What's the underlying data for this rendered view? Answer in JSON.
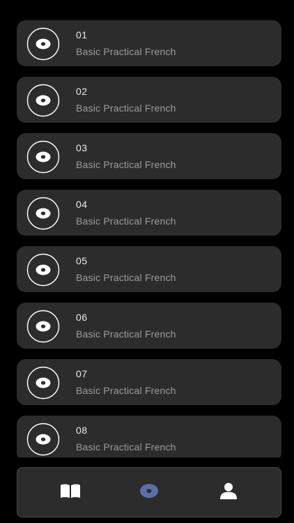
{
  "tracks": [
    {
      "number": "01",
      "subtitle": "Basic Practical French"
    },
    {
      "number": "02",
      "subtitle": "Basic Practical French"
    },
    {
      "number": "03",
      "subtitle": "Basic Practical French"
    },
    {
      "number": "04",
      "subtitle": "Basic Practical French"
    },
    {
      "number": "05",
      "subtitle": "Basic Practical French"
    },
    {
      "number": "06",
      "subtitle": "Basic Practical French"
    },
    {
      "number": "07",
      "subtitle": "Basic Practical French"
    },
    {
      "number": "08",
      "subtitle": "Basic Practical French"
    }
  ],
  "tabs": [
    {
      "icon": "book-icon",
      "active": false
    },
    {
      "icon": "disc-icon",
      "active": true
    },
    {
      "icon": "person-icon",
      "active": false
    }
  ],
  "colors": {
    "background": "#000000",
    "card": "#2c2c2c",
    "active_tab": "#5b6fa8",
    "text_primary": "#ececec",
    "text_secondary": "#9c9c9c"
  }
}
